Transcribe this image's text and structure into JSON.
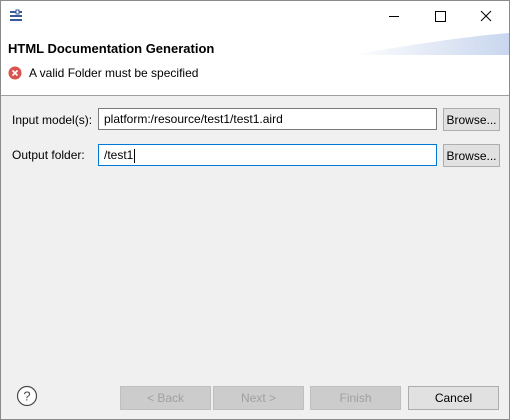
{
  "window": {
    "icon": "wizard-icon",
    "controls": [
      "minimize-icon",
      "maximize-icon",
      "close-icon"
    ]
  },
  "banner": {
    "title": "HTML Documentation Generation",
    "message": "A valid Folder must be specified",
    "message_icon": "error-icon"
  },
  "form": {
    "input_label": "Input model(s):",
    "input_value": "platform:/resource/test1/test1.aird",
    "input_browse": "Browse...",
    "output_label": "Output folder:",
    "output_value": "/test1",
    "output_browse": "Browse..."
  },
  "footer": {
    "help_icon": "help-icon",
    "back": "< Back",
    "next": "Next >",
    "finish": "Finish",
    "cancel": "Cancel"
  }
}
